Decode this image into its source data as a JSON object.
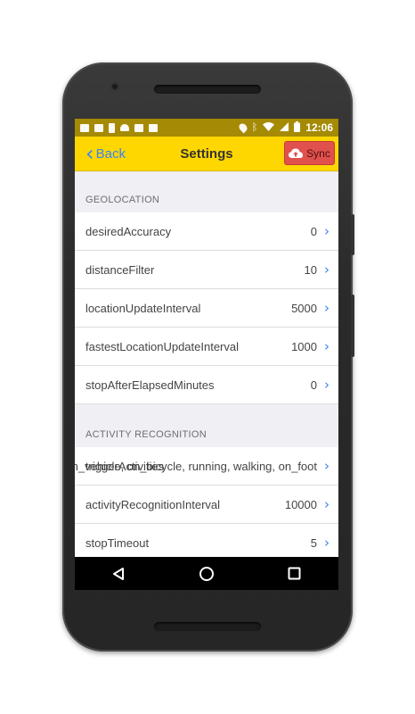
{
  "status_bar": {
    "time": "12:06",
    "left_icons": [
      "gmail-icon",
      "image-icon",
      "download-icon",
      "android-icon",
      "photos-icon",
      "briefcase-icon"
    ],
    "right_icons": [
      "location-icon",
      "bluetooth-icon",
      "wifi-icon",
      "signal-icon",
      "battery-icon"
    ]
  },
  "toolbar": {
    "back_label": "Back",
    "title": "Settings",
    "sync_label": "Sync"
  },
  "sections": [
    {
      "header": "GEOLOCATION",
      "rows": [
        {
          "label": "desiredAccuracy",
          "value": "0"
        },
        {
          "label": "distanceFilter",
          "value": "10"
        },
        {
          "label": "locationUpdateInterval",
          "value": "5000"
        },
        {
          "label": "fastestLocationUpdateInterval",
          "value": "1000"
        },
        {
          "label": "stopAfterElapsedMinutes",
          "value": "0"
        }
      ]
    },
    {
      "header": "ACTIVITY RECOGNITION",
      "rows": [
        {
          "label": "triggerActivities",
          "value": "in_vehicle, on_bicycle, running, walking, on_foot"
        },
        {
          "label": "activityRecognitionInterval",
          "value": "10000"
        },
        {
          "label": "stopTimeout",
          "value": "5"
        }
      ]
    }
  ],
  "colors": {
    "toolbar_bg": "#ffd700",
    "status_bar_bg": "#a58a05",
    "sync_button_bg": "#e0504d",
    "accent_blue": "#3b82f6",
    "list_bg": "#efeff4"
  }
}
